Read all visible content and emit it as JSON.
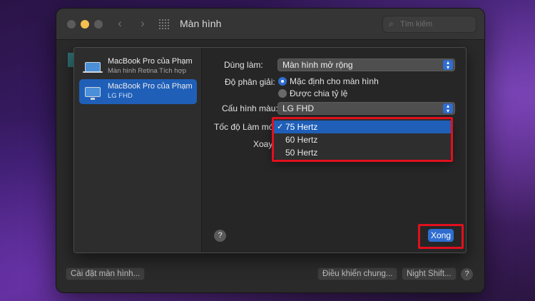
{
  "window": {
    "title": "Màn hình",
    "search_placeholder": "Tìm kiếm"
  },
  "bottom_bar": {
    "left_button": "Cài đặt màn hình...",
    "control_button": "Điều khiển chung...",
    "night_shift_button": "Night Shift...",
    "help": "?"
  },
  "sidebar": {
    "displays": [
      {
        "name": "MacBook Pro của Phạm",
        "subtitle": "Màn hình Retina Tích hợp",
        "selected": false,
        "icon": "laptop-icon"
      },
      {
        "name": "MacBook Pro của Phạm",
        "subtitle": "LG FHD",
        "selected": true,
        "icon": "monitor-icon"
      }
    ]
  },
  "settings": {
    "use_as_label": "Dùng làm:",
    "use_as_value": "Màn hình mở rộng",
    "resolution_label": "Độ phân giải:",
    "resolution_options": [
      "Mặc định cho màn hình",
      "Được chia tỷ lệ"
    ],
    "resolution_selected": "Mặc định cho màn hình",
    "color_profile_label": "Cấu hình màu:",
    "color_profile_value": "LG FHD",
    "refresh_rate_label": "Tốc độ Làm mới",
    "rotation_label": "Xoay",
    "refresh_rate_options": [
      {
        "label": "75 Hertz",
        "checked": true
      },
      {
        "label": "60 Hertz",
        "checked": false
      },
      {
        "label": "50 Hertz",
        "checked": false
      }
    ],
    "check_mark": "✓"
  },
  "sheet_footer": {
    "help": "?",
    "done_button": "Xong"
  },
  "colors": {
    "accent": "#2f6dd0",
    "selection": "#1f5fb8",
    "highlight": "#e0101e"
  }
}
